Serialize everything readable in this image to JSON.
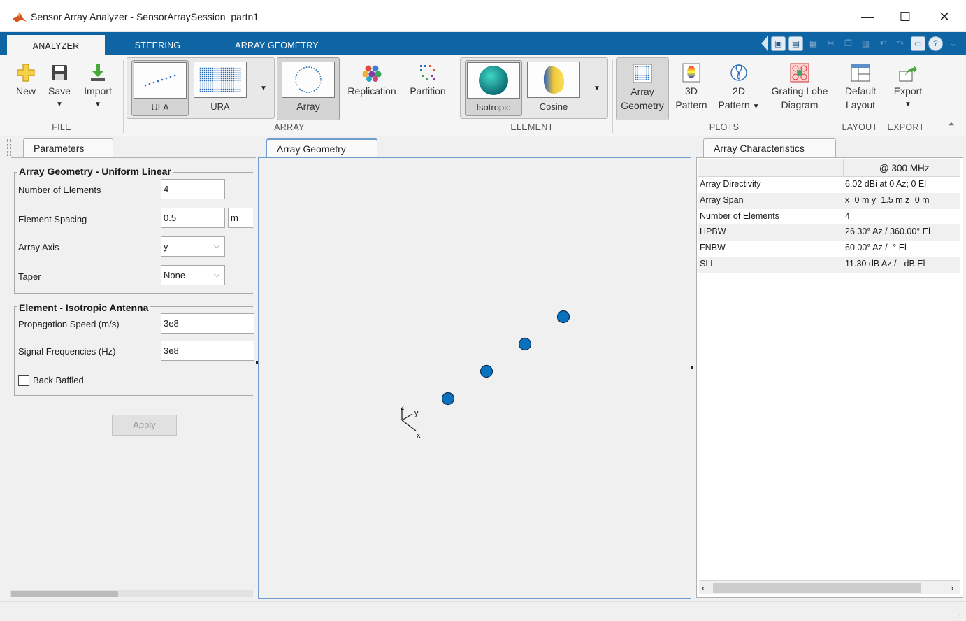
{
  "window": {
    "title": "Sensor Array Analyzer - SensorArraySession_partn1",
    "controls": [
      "—",
      "☐",
      "✕"
    ]
  },
  "tabs": [
    {
      "label": "ANALYZER"
    },
    {
      "label": "STEERING"
    },
    {
      "label": "ARRAY GEOMETRY"
    }
  ],
  "ribbon": {
    "file": {
      "label": "FILE",
      "new_label": "New",
      "save_label": "Save",
      "import_label": "Import"
    },
    "array": {
      "label": "ARRAY",
      "ula_label": "ULA",
      "ura_label": "URA",
      "array_label": "Array",
      "replication_label": "Replication",
      "partition_label": "Partition"
    },
    "element": {
      "label": "ELEMENT",
      "isotropic_label": "Isotropic",
      "cosine_label": "Cosine"
    },
    "plots": {
      "label": "PLOTS",
      "array_geometry_label_1": "Array",
      "array_geometry_label_2": "Geometry",
      "pattern3d_label_1": "3D",
      "pattern3d_label_2": "Pattern",
      "pattern2d_label_1": "2D",
      "pattern2d_label_2": "Pattern",
      "grating_label_1": "Grating Lobe",
      "grating_label_2": "Diagram"
    },
    "layout": {
      "label": "LAYOUT",
      "default_label_1": "Default",
      "default_label_2": "Layout"
    },
    "export": {
      "label": "EXPORT",
      "export_label": "Export"
    }
  },
  "parameters": {
    "tab_label": "Parameters",
    "geometry_section": "Array Geometry - Uniform Linear",
    "num_elements_label": "Number of Elements",
    "num_elements_value": "4",
    "spacing_label": "Element Spacing",
    "spacing_value": "0.5",
    "spacing_unit": "m",
    "axis_label": "Array Axis",
    "axis_value": "y",
    "taper_label": "Taper",
    "taper_value": "None",
    "element_section": "Element - Isotropic Antenna",
    "speed_label": "Propagation Speed (m/s)",
    "speed_value": "3e8",
    "freq_label": "Signal Frequencies (Hz)",
    "freq_value": "3e8",
    "baffled_label": "Back Baffled",
    "baffled_checked": false,
    "apply_label": "Apply"
  },
  "geometry_view": {
    "tab_label": "Array Geometry",
    "axis_labels": {
      "z": "z",
      "y": "y",
      "x": "x"
    },
    "element_color": "#0a72bd",
    "element_count": 4
  },
  "characteristics": {
    "tab_label": "Array Characteristics",
    "header": "@ 300 MHz",
    "rows": [
      {
        "key": "Array Directivity",
        "value": "6.02 dBi at 0 Az; 0 El"
      },
      {
        "key": "Array Span",
        "value": "x=0 m y=1.5 m z=0 m"
      },
      {
        "key": "Number of Elements",
        "value": "4"
      },
      {
        "key": "HPBW",
        "value": "26.30° Az / 360.00° El"
      },
      {
        "key": "FNBW",
        "value": "60.00° Az / -° El"
      },
      {
        "key": "SLL",
        "value": "11.30 dB Az / - dB El"
      }
    ]
  },
  "colors": {
    "accent": "#0f64a3",
    "panel_border": "#6f9ccd"
  }
}
